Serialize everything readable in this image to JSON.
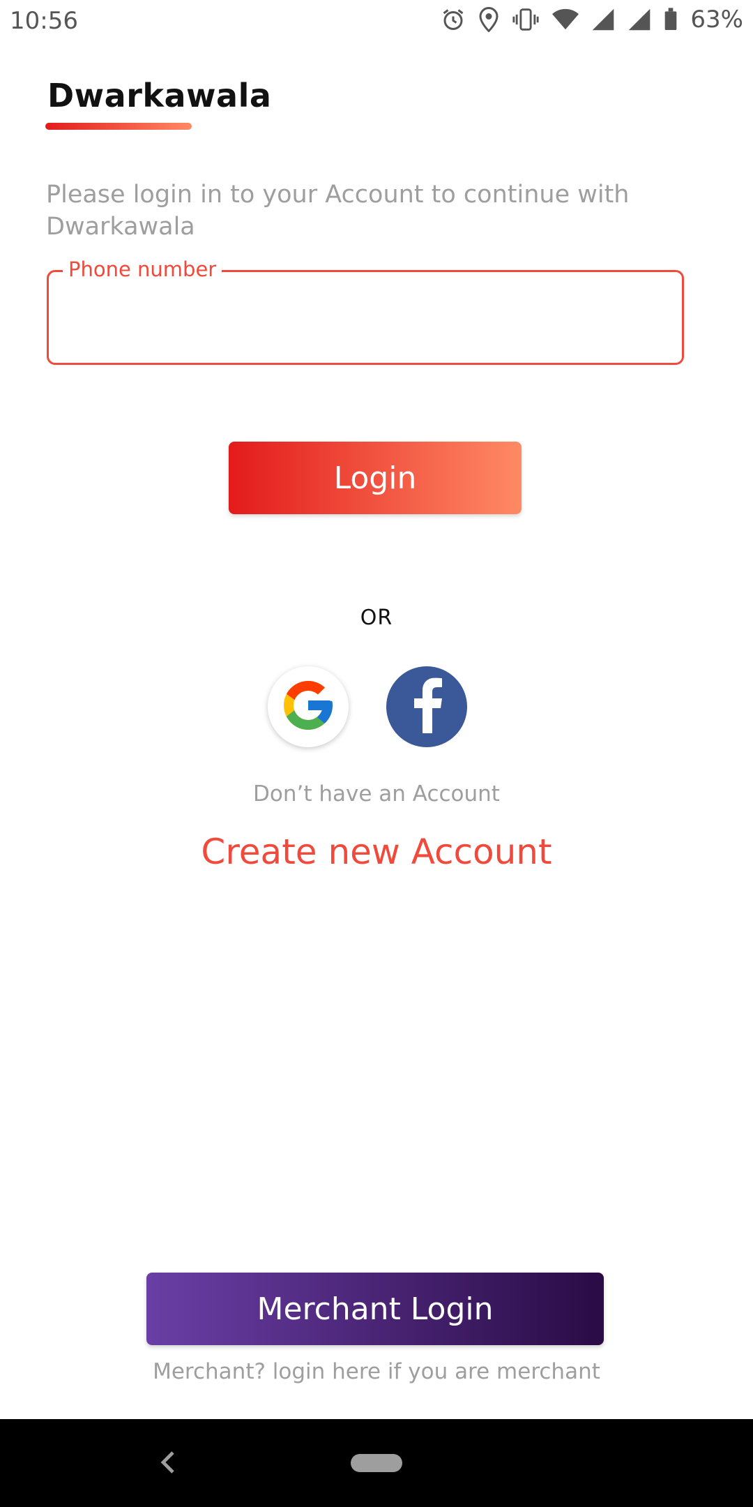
{
  "status_bar": {
    "time": "10:56",
    "battery_percent": "63%",
    "icons": [
      "alarm-icon",
      "location-icon",
      "vibrate-icon",
      "wifi-icon",
      "signal-icon",
      "signal-icon",
      "battery-icon"
    ]
  },
  "brand": {
    "name": "Dwarkawala"
  },
  "intro_text": "Please login in to your Account to continue with Dwarkawala",
  "phone_field": {
    "label": "Phone number",
    "value": ""
  },
  "login_button": {
    "label": "Login"
  },
  "divider_text": "OR",
  "social": [
    {
      "name": "google",
      "icon": "google-icon"
    },
    {
      "name": "facebook",
      "icon": "facebook-icon"
    }
  ],
  "signup": {
    "prompt": "Don’t have an Account",
    "link": "Create new Account"
  },
  "merchant": {
    "button_label": "Merchant Login",
    "hint": "Merchant? login here if you are merchant"
  },
  "colors": {
    "accent_red": "#ef4a3b",
    "gradient_red_start": "#e31b1b",
    "gradient_red_end": "#ff8a65",
    "merchant_gradient_start": "#6a3fa6",
    "merchant_gradient_end": "#2a0b45",
    "facebook_blue": "#3b5999",
    "muted_text": "#9e9e9e"
  }
}
